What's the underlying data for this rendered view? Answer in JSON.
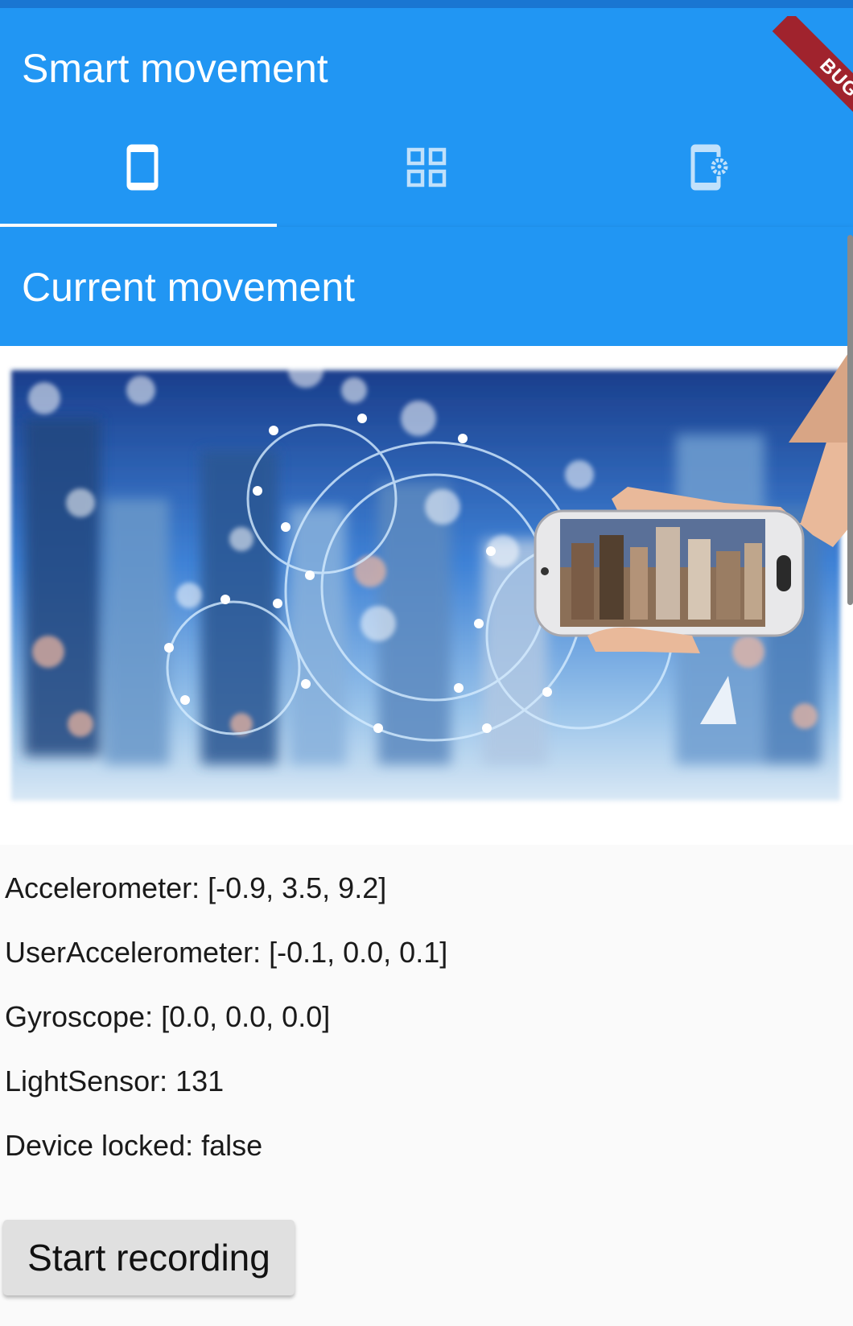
{
  "app_bar": {
    "title": "Smart movement",
    "debug_label": "BUG"
  },
  "tabs": [
    {
      "name": "tab-device",
      "icon": "phone-icon",
      "selected": true
    },
    {
      "name": "tab-dashboard",
      "icon": "grid-icon",
      "selected": false
    },
    {
      "name": "tab-device-settings",
      "icon": "phone-settings-icon",
      "selected": false
    }
  ],
  "section": {
    "title": "Current movement"
  },
  "readings": {
    "accelerometer": "Accelerometer: [-0.9, 3.5, 9.2]",
    "user_accelerometer": "UserAccelerometer: [-0.1, 0.0, 0.1]",
    "gyroscope": "Gyroscope: [0.0, 0.0, 0.0]",
    "light_sensor": "LightSensor: 131",
    "device_locked": "Device locked: false"
  },
  "actions": {
    "record_label": "Start recording"
  },
  "colors": {
    "primary": "#2196f3",
    "primary_dark": "#1976d2",
    "debug": "#a0232d"
  }
}
